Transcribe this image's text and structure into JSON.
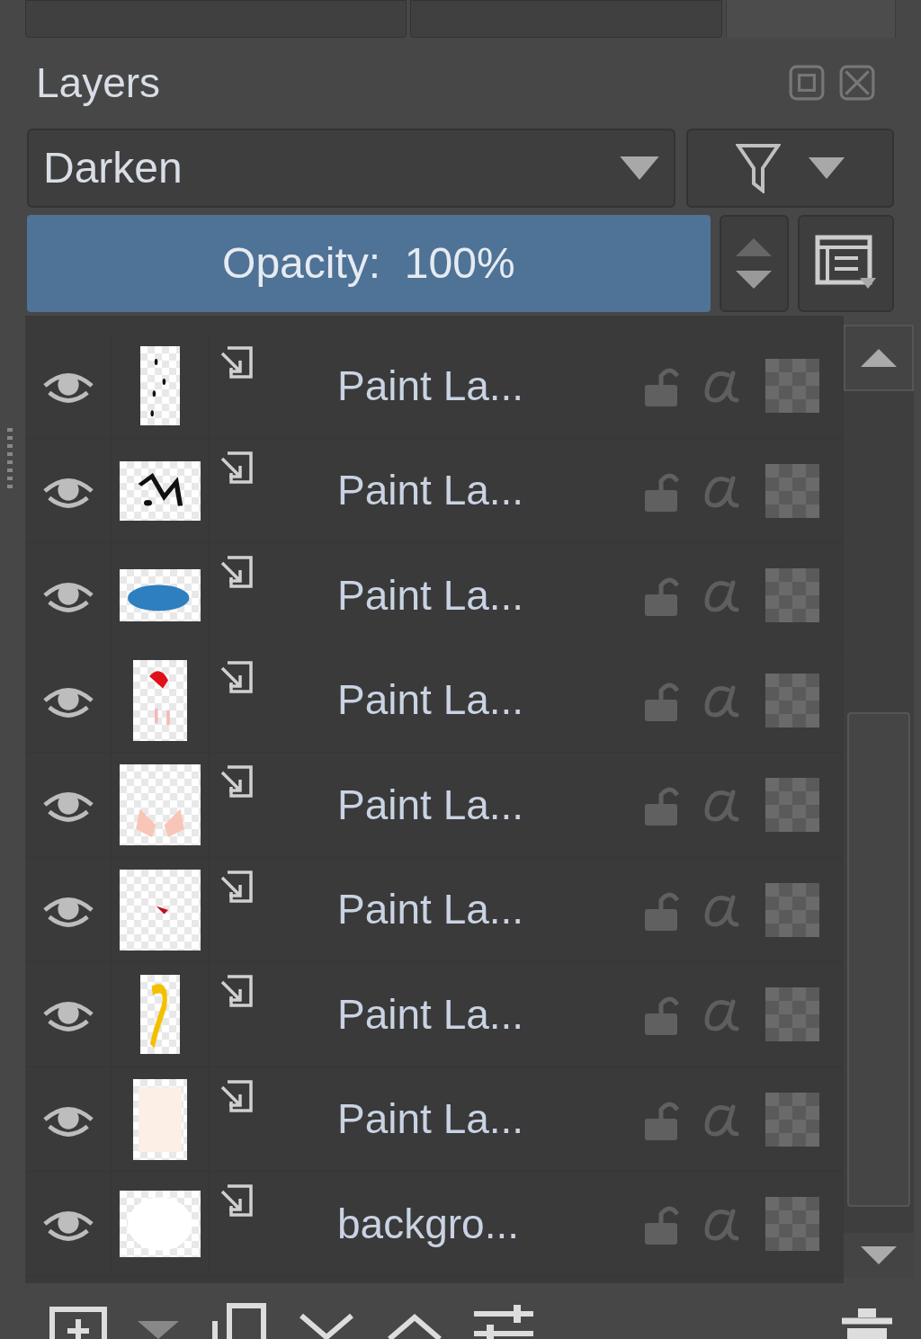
{
  "tabs": [
    {
      "selected": false
    },
    {
      "selected": false
    },
    {
      "selected": true
    }
  ],
  "docker": {
    "title": "Layers"
  },
  "blend_mode": {
    "value": "Darken"
  },
  "opacity": {
    "label": "Opacity:  100%",
    "level": 1
  },
  "layers": [
    {
      "name": "Paint La...",
      "visible": true,
      "locked": false
    },
    {
      "name": "Paint La...",
      "visible": true,
      "locked": false
    },
    {
      "name": "Paint La...",
      "visible": true,
      "locked": false
    },
    {
      "name": "Paint La...",
      "visible": true,
      "locked": false
    },
    {
      "name": "Paint La...",
      "visible": true,
      "locked": false
    },
    {
      "name": "Paint La...",
      "visible": true,
      "locked": false
    },
    {
      "name": "Paint La...",
      "visible": true,
      "locked": false
    },
    {
      "name": "Paint La...",
      "visible": true,
      "locked": false
    },
    {
      "name": "backgro...",
      "visible": true,
      "locked": false
    }
  ]
}
